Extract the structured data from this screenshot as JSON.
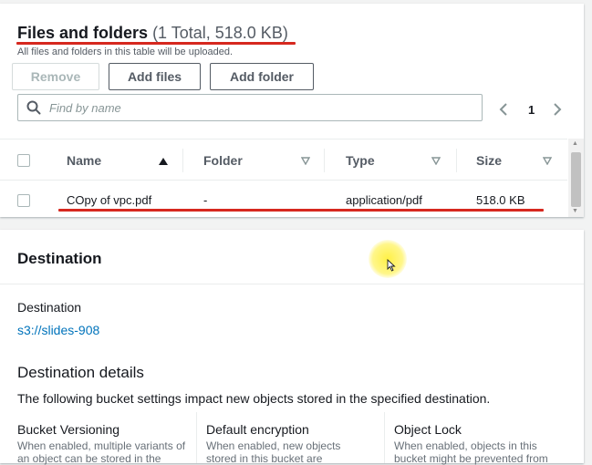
{
  "files": {
    "title": "Files and folders",
    "count": "(1 Total, 518.0 KB)",
    "subtitle": "All files and folders in this table will be uploaded.",
    "buttons": {
      "remove": "Remove",
      "add_files": "Add files",
      "add_folder": "Add folder"
    },
    "search": {
      "placeholder": "Find by name",
      "icon": "search-icon"
    },
    "pagination": {
      "current_page": "1"
    },
    "columns": [
      "Name",
      "Folder",
      "Type",
      "Size"
    ],
    "rows": [
      {
        "name": "COpy of vpc.pdf",
        "folder": "-",
        "type": "application/pdf",
        "size": "518.0 KB"
      }
    ]
  },
  "destination": {
    "title": "Destination",
    "label": "Destination",
    "link": "s3://slides-908",
    "details_title": "Destination details",
    "details_desc": "The following bucket settings impact new objects stored in the specified destination.",
    "cards": [
      {
        "title": "Bucket Versioning",
        "desc": "When enabled, multiple variants of an object can be stored in the"
      },
      {
        "title": "Default encryption",
        "desc": "When enabled, new objects stored in this bucket are"
      },
      {
        "title": "Object Lock",
        "desc": "When enabled, objects in this bucket might be prevented from"
      }
    ]
  },
  "colors": {
    "annotation_red": "#d6281f",
    "link_blue": "#0073bb",
    "cursor_highlight": "#fff03c"
  }
}
